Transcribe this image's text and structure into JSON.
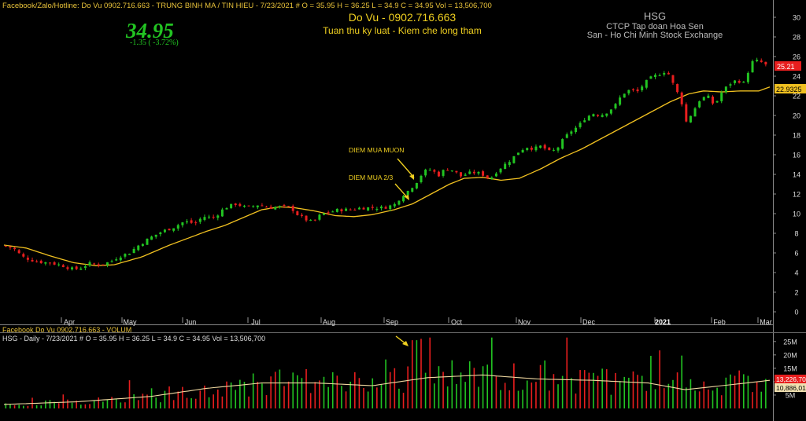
{
  "header": {
    "top_line": "Facebook/Zalo/Hotline: Do Vu 0902.716.663 - TRUNG BINH MA / TIN HIEU   - 7/23/2021   #   O = 35.95  H = 36.25  L = 34.9  C = 34.95  Vol = 13,506,700",
    "price": "34.95",
    "change": "-1.35  ( -3.72%)",
    "author": "Do Vu - 0902.716.663",
    "slogan": "Tuan thu ky luat - Kiem che long tham",
    "ticker": "HSG",
    "company": "CTCP Tap doan Hoa Sen",
    "exchange": "San - Ho Chi Minh Stock Exchange"
  },
  "volume_header": {
    "line1": "Facebook Do Vu 0902.716.663 - VOLUM",
    "line2": "HSG - Daily  - 7/23/2021  #  O = 35.95  H = 36.25  L = 34.9  C = 34.95  Vol = 13,506,700"
  },
  "annotations": {
    "mua_muon": "DIEM MUA MUON",
    "mua_23": "DIEM MUA 2/3"
  },
  "colors": {
    "up": "#22c422",
    "down": "#e81e1e",
    "ma": "#f0c020",
    "volume_ma": "#f0d8a0",
    "grid": "#1a1a1a",
    "axis_text": "#dddddd"
  },
  "chart_data": [
    {
      "type": "candlestick",
      "ticker": "HSG",
      "x_ticks": [
        "Apr",
        "May",
        "Jun",
        "Jul",
        "Aug",
        "Sep",
        "Oct",
        "Nov",
        "Dec",
        "2021",
        "Feb",
        "Mar"
      ],
      "y_ticks": [
        0,
        2,
        4,
        6,
        8,
        10,
        12,
        14,
        16,
        18,
        20,
        22,
        24,
        26,
        28,
        30
      ],
      "ylim": [
        -0.5,
        31.5
      ],
      "last_price_label": "25.21",
      "ma_label": "22.9325",
      "ma_points": [
        [
          0,
          6.8
        ],
        [
          12,
          6.5
        ],
        [
          25,
          5.7
        ],
        [
          38,
          5.0
        ],
        [
          50,
          4.7
        ],
        [
          60,
          4.8
        ],
        [
          75,
          5.6
        ],
        [
          90,
          6.8
        ],
        [
          100,
          7.5
        ],
        [
          110,
          8.2
        ],
        [
          120,
          8.8
        ],
        [
          130,
          9.6
        ],
        [
          140,
          10.4
        ],
        [
          150,
          10.7
        ],
        [
          158,
          10.6
        ],
        [
          168,
          10.3
        ],
        [
          180,
          9.8
        ],
        [
          190,
          9.7
        ],
        [
          200,
          9.9
        ],
        [
          212,
          10.4
        ],
        [
          222,
          11.0
        ],
        [
          232,
          12.0
        ],
        [
          242,
          13.0
        ],
        [
          250,
          13.6
        ],
        [
          260,
          13.7
        ],
        [
          270,
          13.4
        ],
        [
          280,
          13.6
        ],
        [
          292,
          14.6
        ],
        [
          302,
          15.6
        ],
        [
          314,
          16.6
        ],
        [
          326,
          17.8
        ],
        [
          338,
          19.0
        ],
        [
          350,
          20.2
        ],
        [
          362,
          21.4
        ],
        [
          372,
          22.2
        ],
        [
          380,
          22.5
        ],
        [
          390,
          22.4
        ],
        [
          400,
          22.5
        ],
        [
          410,
          22.5
        ],
        [
          416,
          22.9
        ]
      ],
      "close_points": [
        [
          0,
          6.7
        ],
        [
          5,
          6.5
        ],
        [
          10,
          5.6
        ],
        [
          18,
          5.1
        ],
        [
          25,
          5.0
        ],
        [
          32,
          4.7
        ],
        [
          38,
          4.3
        ],
        [
          42,
          4.5
        ],
        [
          46,
          4.9
        ],
        [
          52,
          4.8
        ],
        [
          58,
          5.1
        ],
        [
          62,
          5.6
        ],
        [
          68,
          6.0
        ],
        [
          74,
          6.9
        ],
        [
          80,
          7.6
        ],
        [
          86,
          8.2
        ],
        [
          92,
          8.6
        ],
        [
          98,
          9.2
        ],
        [
          104,
          9.0
        ],
        [
          108,
          9.7
        ],
        [
          114,
          9.6
        ],
        [
          120,
          10.6
        ],
        [
          126,
          11.0
        ],
        [
          132,
          10.6
        ],
        [
          138,
          10.9
        ],
        [
          144,
          10.6
        ],
        [
          150,
          10.7
        ],
        [
          156,
          10.6
        ],
        [
          160,
          9.8
        ],
        [
          164,
          9.4
        ],
        [
          168,
          9.1
        ],
        [
          172,
          9.9
        ],
        [
          176,
          10.1
        ],
        [
          182,
          10.4
        ],
        [
          188,
          10.4
        ],
        [
          194,
          10.6
        ],
        [
          200,
          10.6
        ],
        [
          206,
          10.6
        ],
        [
          212,
          10.9
        ],
        [
          216,
          11.8
        ],
        [
          220,
          12.4
        ],
        [
          224,
          13.2
        ],
        [
          228,
          14.3
        ],
        [
          232,
          14.5
        ],
        [
          236,
          13.9
        ],
        [
          240,
          14.6
        ],
        [
          244,
          14.4
        ],
        [
          248,
          13.8
        ],
        [
          252,
          14.1
        ],
        [
          256,
          14.2
        ],
        [
          260,
          14.0
        ],
        [
          264,
          13.5
        ],
        [
          268,
          14.4
        ],
        [
          272,
          15.0
        ],
        [
          276,
          15.6
        ],
        [
          280,
          16.4
        ],
        [
          284,
          16.8
        ],
        [
          288,
          16.6
        ],
        [
          292,
          16.9
        ],
        [
          296,
          16.3
        ],
        [
          300,
          16.5
        ],
        [
          304,
          17.6
        ],
        [
          308,
          18.4
        ],
        [
          312,
          18.9
        ],
        [
          316,
          19.8
        ],
        [
          320,
          20.2
        ],
        [
          324,
          20.0
        ],
        [
          328,
          20.4
        ],
        [
          332,
          21.0
        ],
        [
          336,
          22.2
        ],
        [
          340,
          22.6
        ],
        [
          344,
          22.4
        ],
        [
          348,
          23.3
        ],
        [
          352,
          23.9
        ],
        [
          356,
          24.2
        ],
        [
          360,
          24.6
        ],
        [
          364,
          23.0
        ],
        [
          368,
          21.5
        ],
        [
          370,
          19.2
        ],
        [
          374,
          20.3
        ],
        [
          378,
          21.6
        ],
        [
          382,
          22.0
        ],
        [
          386,
          21.0
        ],
        [
          390,
          22.4
        ],
        [
          394,
          23.2
        ],
        [
          398,
          23.6
        ],
        [
          402,
          23.3
        ],
        [
          406,
          25.4
        ],
        [
          410,
          25.6
        ],
        [
          414,
          25.1
        ]
      ],
      "annotations": [
        "DIEM MUA MUON",
        "DIEM MUA 2/3"
      ]
    },
    {
      "type": "bar",
      "title": "VOLUM",
      "y_ticks": [
        "25M",
        "20M",
        "15M",
        "10M",
        "5M"
      ],
      "last_volume_label": "13,226,70",
      "ma_volume_label": "10,886,01"
    }
  ]
}
